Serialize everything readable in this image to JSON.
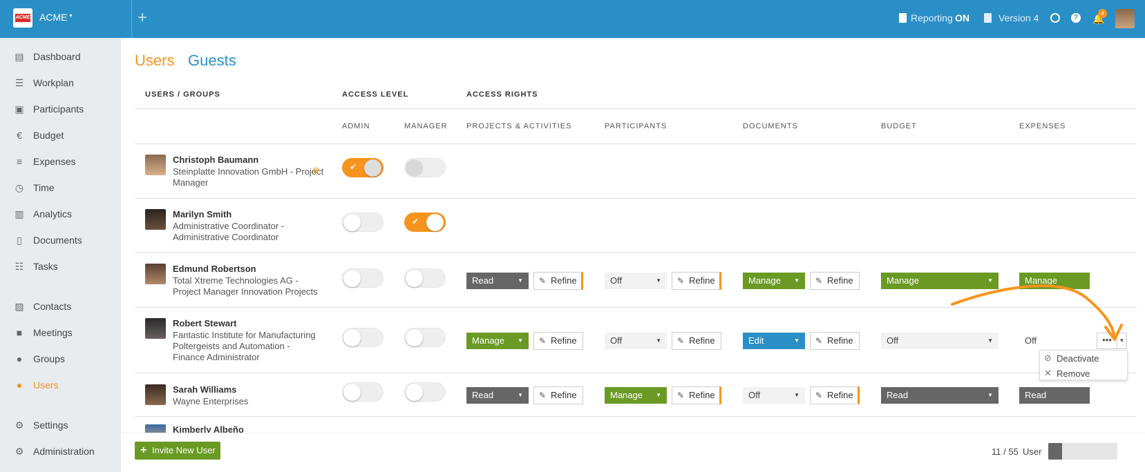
{
  "topbar": {
    "logo_text": "ACME",
    "app_name": "ACME",
    "reporting_label": "Reporting",
    "reporting_state": "ON",
    "version_label": "Version 4",
    "notification_count": "4",
    "accent": "#2b8fc7"
  },
  "sidebar": {
    "items": [
      {
        "label": "Dashboard",
        "icon": "dashboard-icon"
      },
      {
        "label": "Workplan",
        "icon": "workplan-icon"
      },
      {
        "label": "Participants",
        "icon": "briefcase-icon"
      },
      {
        "label": "Budget",
        "icon": "euro-icon"
      },
      {
        "label": "Expenses",
        "icon": "expenses-icon"
      },
      {
        "label": "Time",
        "icon": "clock-icon"
      },
      {
        "label": "Analytics",
        "icon": "bar-chart-icon"
      },
      {
        "label": "Documents",
        "icon": "document-icon"
      },
      {
        "label": "Tasks",
        "icon": "list-icon"
      },
      {
        "label": "Contacts",
        "icon": "contacts-icon"
      },
      {
        "label": "Meetings",
        "icon": "video-icon"
      },
      {
        "label": "Groups",
        "icon": "group-icon"
      },
      {
        "label": "Users",
        "icon": "user-icon",
        "active": true
      },
      {
        "label": "Settings",
        "icon": "gear-icon"
      },
      {
        "label": "Administration",
        "icon": "gear-icon"
      }
    ]
  },
  "tabs": {
    "users": "Users",
    "guests": "Guests"
  },
  "headers": {
    "users_groups": "USERS / GROUPS",
    "access_level": "ACCESS LEVEL",
    "access_rights": "ACCESS RIGHTS",
    "admin": "ADMIN",
    "manager": "MANAGER",
    "projects": "PROJECTS & ACTIVITIES",
    "participants": "PARTICIPANTS",
    "documents": "DOCUMENTS",
    "budget": "BUDGET",
    "expenses": "EXPENSES"
  },
  "rows": [
    {
      "name": "Christoph Baumann",
      "sub": "Steinplatte Innovation GmbH - Project Manager",
      "admin": true,
      "manager": "disabled",
      "crown": true
    },
    {
      "name": "Marilyn Smith",
      "sub": "Administrative Coordinator - Administrative Coordinator",
      "admin": false,
      "manager": true
    },
    {
      "name": "Edmund Robertson",
      "sub": "Total Xtreme Technologies AG - Project Manager Innovation Projects",
      "admin": false,
      "manager": false,
      "rights": {
        "projects": "Read",
        "participants": "Off",
        "documents": "Manage",
        "budget": "Manage",
        "expenses": "Manage"
      }
    },
    {
      "name": "Robert Stewart",
      "sub": "Fantastic Institute for Manufacturing Poltergeists and Automation - Finance Administrator",
      "admin": false,
      "manager": false,
      "rights": {
        "projects": "Manage",
        "participants": "Off",
        "documents": "Edit",
        "budget": "Off",
        "expenses": "Off"
      }
    },
    {
      "name": "Sarah Williams",
      "sub": "Wayne Enterprises",
      "admin": false,
      "manager": false,
      "rights": {
        "projects": "Read",
        "participants": "Manage",
        "documents": "Off",
        "budget": "Read",
        "expenses": "Read"
      }
    },
    {
      "name": "Kimberly Albeño",
      "sub": ""
    }
  ],
  "refine_label": "Refine",
  "more_label": "•••",
  "menu": {
    "deactivate": "Deactivate",
    "remove": "Remove"
  },
  "footer": {
    "invite_label": "Invite New User",
    "count": "11 / 55",
    "count_label": "User",
    "progress_fraction": 0.2
  }
}
